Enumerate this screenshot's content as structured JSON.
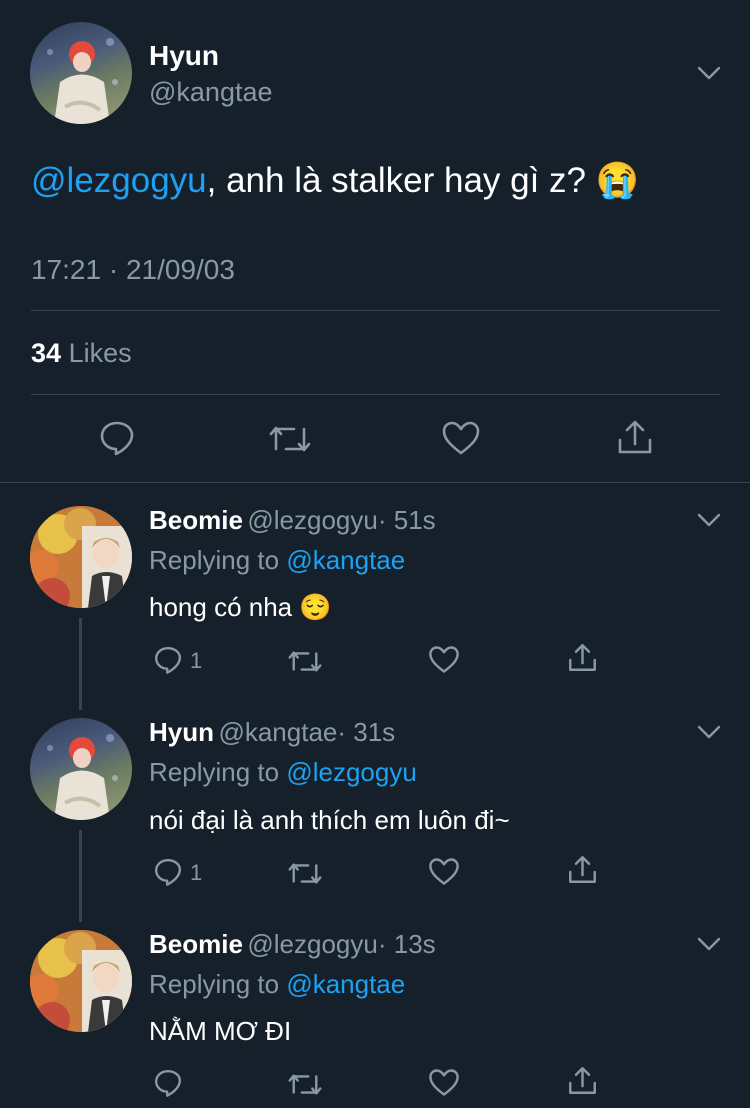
{
  "main_tweet": {
    "author_name": "Hyun",
    "author_handle": "@kangtae",
    "mention": "@lezgogyu",
    "text": ", anh là stalker hay gì z?",
    "emoji": "😭",
    "timestamp": "17:21 · 21/09/03",
    "likes_count": "34",
    "likes_label": "Likes"
  },
  "replies": [
    {
      "author_name": "Beomie",
      "author_handle": "@lezgogyu",
      "age": "· 51s",
      "replying_prefix": "Replying to",
      "replying_to": "@kangtae",
      "text": "hong có nha",
      "emoji": "😌",
      "reply_count": "1"
    },
    {
      "author_name": "Hyun",
      "author_handle": "@kangtae",
      "age": "· 31s",
      "replying_prefix": "Replying to",
      "replying_to": "@lezgogyu",
      "text": "nói đại là anh thích em luôn đi~",
      "emoji": "",
      "reply_count": "1"
    },
    {
      "author_name": "Beomie",
      "author_handle": "@lezgogyu",
      "age": "· 13s",
      "replying_prefix": "Replying to",
      "replying_to": "@kangtae",
      "text": "NẰM MƠ ĐI",
      "emoji": "",
      "reply_count": ""
    }
  ],
  "icons": {
    "reply": "reply-icon",
    "retweet": "retweet-icon",
    "like": "heart-icon",
    "share": "share-icon",
    "more": "chevron-down-icon"
  },
  "colors": {
    "background": "#15202b",
    "accent": "#1da1f2",
    "muted": "#8899a6",
    "divider": "#38444d"
  }
}
